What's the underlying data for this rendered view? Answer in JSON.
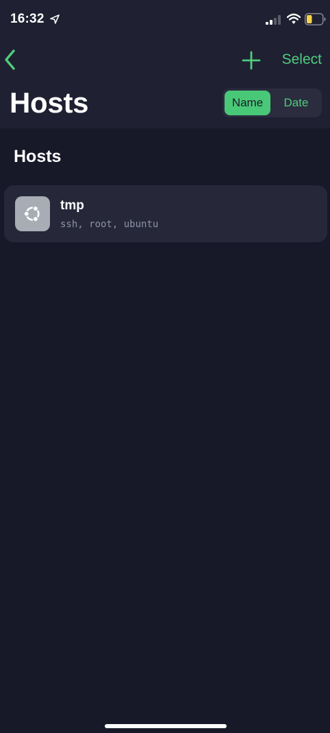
{
  "status_bar": {
    "time": "16:32",
    "icons": [
      "location-arrow-icon",
      "cellular-signal-icon",
      "wifi-icon",
      "battery-icon"
    ]
  },
  "nav": {
    "back_icon": "chevron-left-icon",
    "add_icon": "plus-icon",
    "select_label": "Select"
  },
  "title": "Hosts",
  "sort": {
    "options": [
      "Name",
      "Date"
    ],
    "selected": "Name"
  },
  "section": {
    "title": "Hosts"
  },
  "hosts": [
    {
      "name": "tmp",
      "details": "ssh, root, ubuntu",
      "icon": "ubuntu-icon"
    }
  ],
  "colors": {
    "accent": "#4fcd7f",
    "background": "#171828",
    "header_background": "#1f2031",
    "card_background": "#26283a",
    "segment_selected": "#49c977",
    "battery_low": "#f5d34a"
  }
}
